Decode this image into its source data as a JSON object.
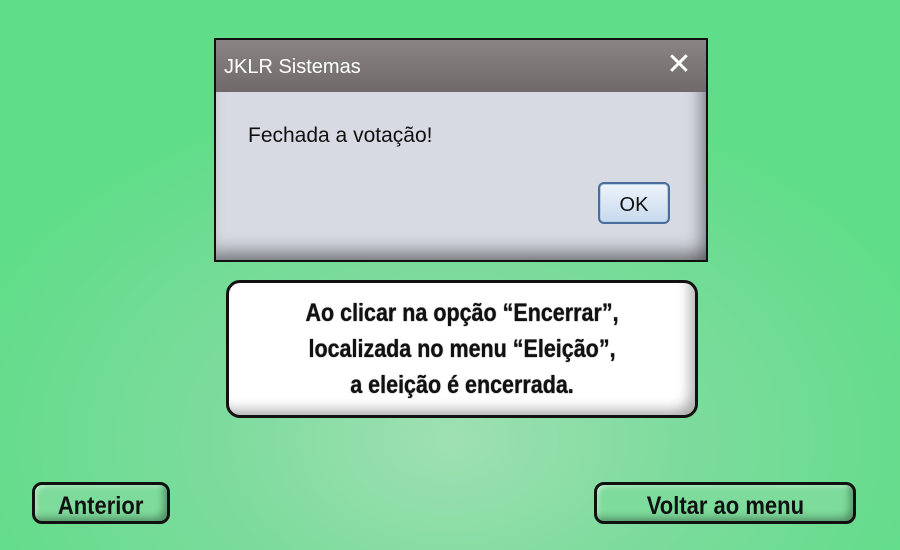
{
  "dialog": {
    "title": "JKLR Sistemas",
    "close_icon": "close-icon",
    "message": "Fechada a votação!",
    "ok_label": "OK"
  },
  "callout": {
    "lines": [
      "Ao clicar na opção “Encerrar”,",
      "localizada no menu “Eleição”,",
      "a eleição é encerrada."
    ]
  },
  "navigation": {
    "previous_label": "Anterior",
    "menu_label": "Voltar ao menu"
  },
  "colors": {
    "background": "#5fdd88",
    "titlebar": "#7a7574",
    "dialog_body": "#d7dae3",
    "nav_button": "#7ddb9b"
  }
}
